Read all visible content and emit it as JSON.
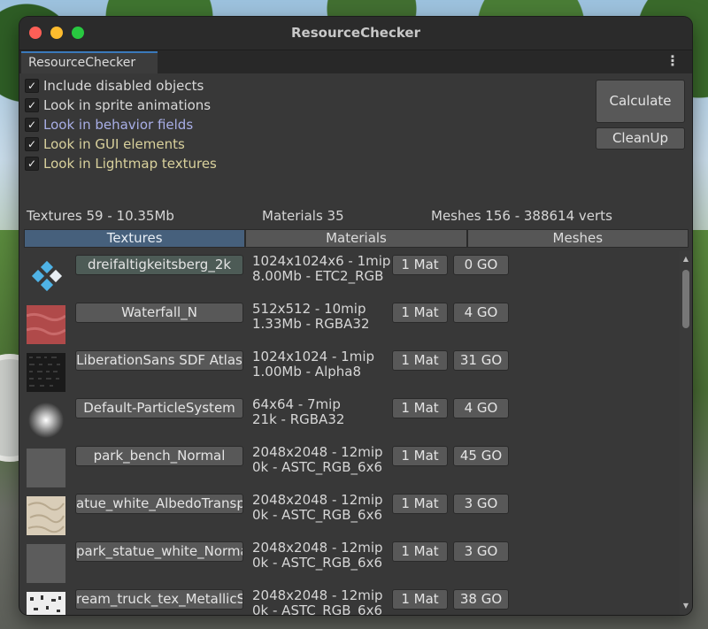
{
  "window": {
    "title": "ResourceChecker"
  },
  "tab": {
    "label": "ResourceChecker",
    "menu_icon": "⋮"
  },
  "options": [
    {
      "label": "Include disabled objects",
      "checked": true,
      "color": "#d8d8d8"
    },
    {
      "label": "Look in sprite animations",
      "checked": true,
      "color": "#d8d8d8"
    },
    {
      "label": "Look in behavior fields",
      "checked": true,
      "color": "#a8aee6"
    },
    {
      "label": "Look in GUI elements",
      "checked": true,
      "color": "#d9d19c"
    },
    {
      "label": "Look in Lightmap textures",
      "checked": true,
      "color": "#d9d19c"
    }
  ],
  "buttons": {
    "calculate": "Calculate",
    "cleanup": "CleanUp"
  },
  "stats": {
    "textures": "Textures 59 - 10.35Mb",
    "materials": "Materials 35",
    "meshes": "Meshes 156 - 388614 verts"
  },
  "segments": [
    "Textures",
    "Materials",
    "Meshes"
  ],
  "active_segment": "Textures",
  "rows": [
    {
      "name": "dreifaltigkeitsberg_2k",
      "info1": "1024x1024x6 - 1mip",
      "info2": "8.00Mb - ETC2_RGB",
      "mat": "1 Mat",
      "go": "0 GO",
      "thumb": "logo"
    },
    {
      "name": "Waterfall_N",
      "info1": "512x512 - 10mip",
      "info2": "1.33Mb - RGBA32",
      "mat": "1 Mat",
      "go": "4 GO",
      "thumb": "red"
    },
    {
      "name": "LiberationSans SDF Atlas",
      "info1": "1024x1024 - 1mip",
      "info2": "1.00Mb - Alpha8",
      "mat": "1 Mat",
      "go": "31 GO",
      "thumb": "dark"
    },
    {
      "name": "Default-ParticleSystem",
      "info1": "64x64 - 7mip",
      "info2": "21k - RGBA32",
      "mat": "1 Mat",
      "go": "4 GO",
      "thumb": "glow"
    },
    {
      "name": "park_bench_Normal",
      "info1": "2048x2048 - 12mip",
      "info2": "0k - ASTC_RGB_6x6",
      "mat": "1 Mat",
      "go": "45 GO",
      "thumb": "grey"
    },
    {
      "name": "atue_white_AlbedoTransp",
      "info1": "2048x2048 - 12mip",
      "info2": "0k - ASTC_RGB_6x6",
      "mat": "1 Mat",
      "go": "3 GO",
      "thumb": "marble"
    },
    {
      "name": "park_statue_white_Norma",
      "info1": "2048x2048 - 12mip",
      "info2": "0k - ASTC_RGB_6x6",
      "mat": "1 Mat",
      "go": "3 GO",
      "thumb": "grey"
    },
    {
      "name": "ream_truck_tex_MetallicS",
      "info1": "2048x2048 - 12mip",
      "info2": "0k - ASTC_RGB_6x6",
      "mat": "1 Mat",
      "go": "38 GO",
      "thumb": "spots"
    }
  ],
  "colors": {
    "accent": "#3a79bb",
    "active_segment": "#46607c"
  }
}
